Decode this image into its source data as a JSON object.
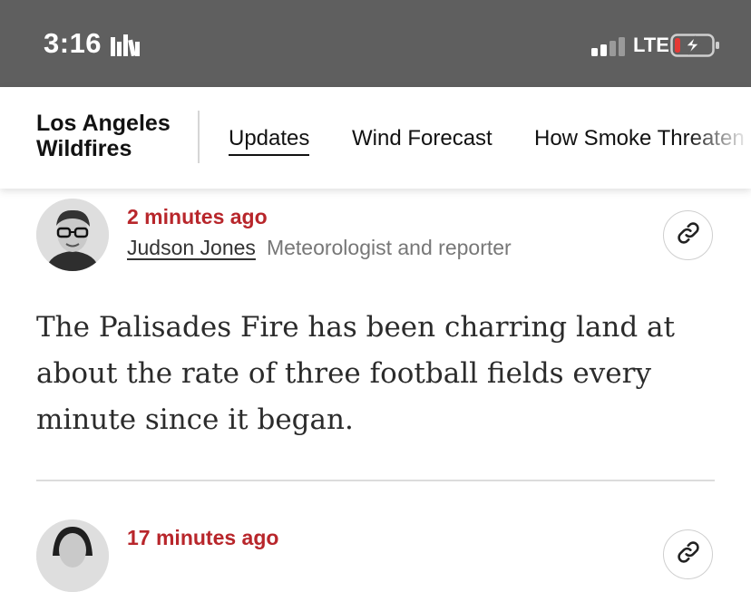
{
  "status_bar": {
    "time": "3:16",
    "network": "LTE",
    "books_icon": "books-icon",
    "signal_icon": "cellular-signal-icon",
    "battery_icon": "battery-charging-icon",
    "battery_level": 0.15,
    "battery_color": "#e53935"
  },
  "nav": {
    "section_title": "Los Angeles Wildfires",
    "tabs": [
      {
        "label": "Updates",
        "selected": true
      },
      {
        "label": "Wind Forecast",
        "selected": false
      },
      {
        "label": "How Smoke Threaten",
        "selected": false
      }
    ]
  },
  "posts": [
    {
      "time_ago": "2 minutes ago",
      "author": "Judson Jones",
      "role": "Meteorologist and reporter",
      "text": "The Palisades Fire has been charring land at about the rate of three football fields every minute since it began.",
      "link_icon": "link-icon"
    },
    {
      "time_ago": "17 minutes ago",
      "link_icon": "link-icon"
    }
  ],
  "colors": {
    "status_bar_bg": "#5f5f5f",
    "timestamp_red": "#b8262b",
    "text_dark": "#121212"
  }
}
